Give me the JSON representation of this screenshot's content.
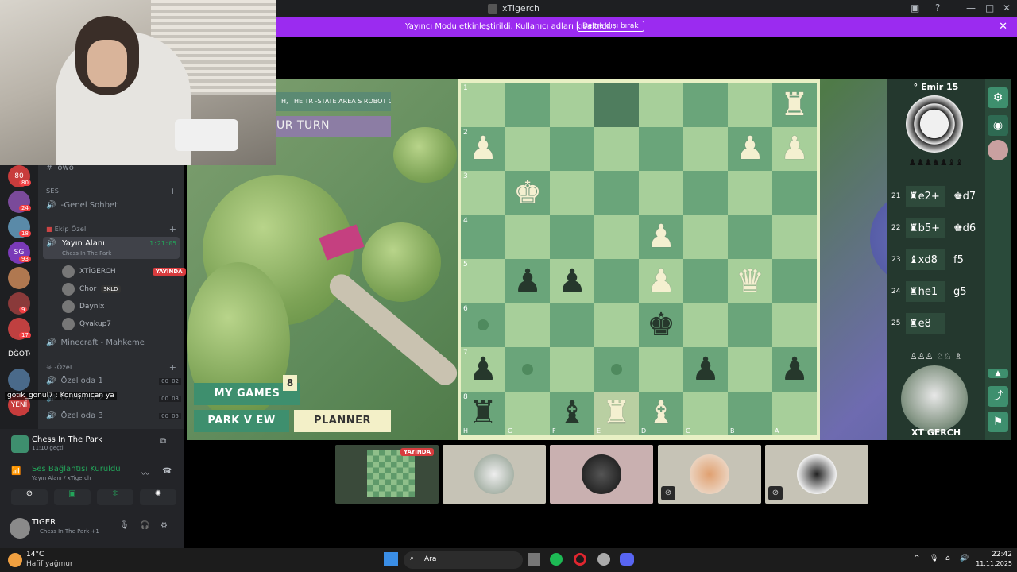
{
  "window": {
    "title": "xTigerch"
  },
  "banner": {
    "message": "Yayıncı Modu etkinleştirildi. Kullanıcı adları kısaltıldı.",
    "button": "Devre dışı bırak"
  },
  "game": {
    "robot_text": "H, THE TR -STATE AREA  S ROBOT C",
    "turn_text": "UR TURN",
    "buttons": {
      "my_games": "MY GAMES",
      "my_games_count": "8",
      "park_view": "PARK V EW",
      "planner": "PLANNER"
    },
    "ranks": [
      "1",
      "2",
      "3",
      "4",
      "5",
      "6",
      "7",
      "8"
    ],
    "files": [
      "H",
      "G",
      "F",
      "E",
      "D",
      "C",
      "B",
      "A"
    ],
    "board": [
      [
        "",
        "",
        "",
        "hl",
        "",
        "",
        "",
        "wR"
      ],
      [
        "wP",
        "",
        "",
        "",
        "",
        "",
        "wP",
        "wP"
      ],
      [
        "",
        "wK",
        "",
        "",
        "",
        "",
        "",
        ""
      ],
      [
        "",
        "",
        "",
        "",
        "wP",
        "",
        "",
        ""
      ],
      [
        "",
        "bP",
        "bP",
        "",
        "wP",
        "",
        "wQ",
        ""
      ],
      [
        "dot",
        "",
        "",
        "",
        "bK",
        "",
        "",
        ""
      ],
      [
        "bP",
        "dot",
        "",
        "dot",
        "",
        "bP",
        "",
        "bP"
      ],
      [
        "bR",
        "",
        "bB",
        "wRhl",
        "wB",
        "",
        "",
        ""
      ]
    ],
    "opponent": {
      "name": "° Emir 15"
    },
    "player": {
      "name": "XT GERCH"
    },
    "moves": [
      {
        "n": "21",
        "w": "♜e2+",
        "b": "♚d7"
      },
      {
        "n": "22",
        "w": "♜b5+",
        "b": "♚d6"
      },
      {
        "n": "23",
        "w": "♝xd8",
        "b": "f5"
      },
      {
        "n": "24",
        "w": "♜he1",
        "b": "g5"
      },
      {
        "n": "25",
        "w": "♜e8",
        "b": ""
      }
    ],
    "captured_top": "♟♟♟♞♟♝♝",
    "captured_bottom": "♙♙♙ ♘♘ ♗"
  },
  "discord": {
    "servers": [
      {
        "label": "80",
        "badge": "80"
      },
      {
        "label": "",
        "badge": "24"
      },
      {
        "label": "",
        "badge": "18"
      },
      {
        "label": "SG",
        "badge": "93"
      },
      {
        "label": "",
        "badge": ""
      },
      {
        "label": "",
        "badge": "9"
      },
      {
        "label": "",
        "badge": "17"
      },
      {
        "label": "DĞOTAŞ.",
        "badge": ""
      },
      {
        "label": "",
        "badge": ""
      },
      {
        "label": "YENİ",
        "badge": ""
      }
    ],
    "top_channel": "owo",
    "cat_voice": "SES",
    "ch_genel": "-Genel Sohbet",
    "cat_ekip": "Ekip Özel",
    "ch_yayin": "Yayın Alanı",
    "ch_yayin_time": "1:21:05",
    "ch_yayin_activity": "Chess In The Park",
    "users": [
      {
        "name": "XTİGERCH",
        "tag": "YAYINDA"
      },
      {
        "name": "Chor",
        "tag": "SKLD"
      },
      {
        "name": "Daynlx",
        "tag": ""
      },
      {
        "name": "Qyakup7",
        "tag": ""
      }
    ],
    "ch_minecraft": "Minecraft - Mahkeme",
    "cat_ozel": "-Özel",
    "ozel_rooms": [
      {
        "name": "Özel oda 1",
        "a": "00",
        "b": "02"
      },
      {
        "name": "Özel oda 2",
        "a": "00",
        "b": "03"
      },
      {
        "name": "Özel oda 3",
        "a": "00",
        "b": "05"
      }
    ],
    "chat_overlay": "gotik_gonul7 : Konuşmıcan ya",
    "activity": {
      "title": "Chess In The Park",
      "time": "11:10 geçti"
    },
    "voice": {
      "status": "Ses Bağlantısı Kuruldu",
      "channel": "Yayın Alanı / xTigerch"
    },
    "me": {
      "name": "TIGER",
      "status": "Chess In The Park +1"
    }
  },
  "thumbs": {
    "live_tag": "YAYINDA"
  },
  "taskbar": {
    "weather_temp": "14°C",
    "weather_desc": "Hafif yağmur",
    "search": "Ara",
    "time": "22:42",
    "date": "11.11.2025"
  }
}
